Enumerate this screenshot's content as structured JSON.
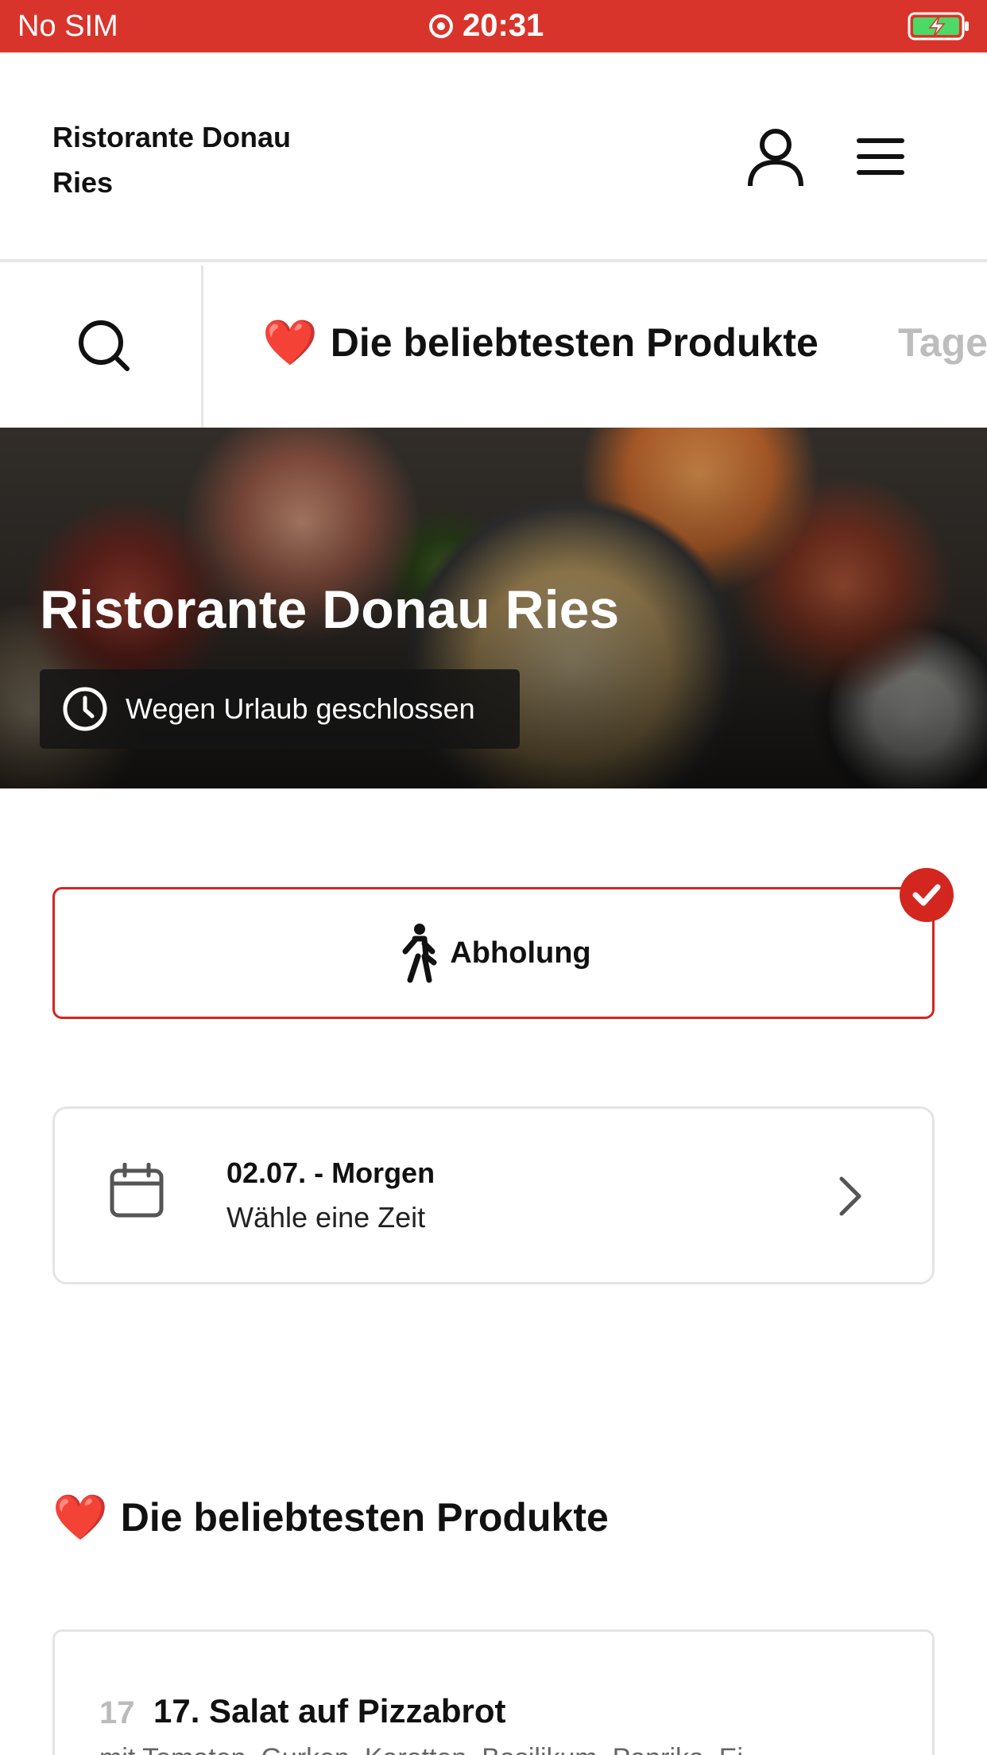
{
  "status_bar": {
    "carrier": "No SIM",
    "time": "20:31",
    "icons": [
      "screen-recording-icon",
      "battery-charging-icon"
    ]
  },
  "header": {
    "brand_line1": "Ristorante Donau",
    "brand_line2": "Ries",
    "icons": [
      "user-icon",
      "hamburger-menu-icon"
    ]
  },
  "category_nav": {
    "active_label": "Die beliebtesten Produkte",
    "active_emoji": "❤️",
    "next_label": "Tage",
    "icons": [
      "search-icon"
    ]
  },
  "hero": {
    "title": "Ristorante Donau Ries",
    "status": "Wegen Urlaub geschlossen"
  },
  "order_mode": {
    "label": "Abholung",
    "selected": true,
    "accent": "#d3261f",
    "icons": [
      "walking-person-icon",
      "checkmark-icon"
    ]
  },
  "date_picker": {
    "title": "02.07. - Morgen",
    "subtitle": "Wähle eine Zeit",
    "icons": [
      "calendar-icon",
      "chevron-right-icon"
    ]
  },
  "popular_section": {
    "emoji": "❤️",
    "title": "Die beliebtesten Produkte"
  },
  "products": [
    {
      "number": "17",
      "name": "17. Salat auf Pizzabrot",
      "description": "mit Tomaten, Gurken, Karotten, Basilikum, Paprika, Ei..."
    }
  ],
  "colors": {
    "status_bar": "#d9342b",
    "accent": "#d3261f",
    "inactive_tab": "#bdbdbd"
  }
}
